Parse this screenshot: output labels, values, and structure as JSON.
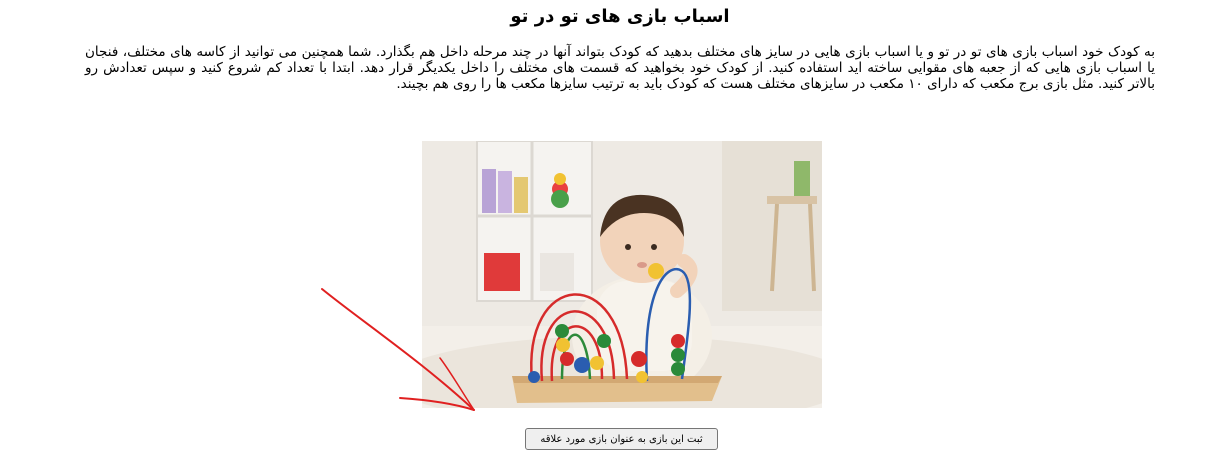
{
  "article": {
    "title": "اسباب بازی های تو در تو",
    "paragraph": "به کودک خود اسباب بازی های تو در تو و یا اسباب بازی هایی در سایز های مختلف بدهید که کودک بتواند آنها در چند مرحله داخل هم بگذارد. شما همچنین می توانید از کاسه های مختلف، فنجان یا اسباب بازی هایی که از جعبه های مقوایی ساخته اید استفاده کنید. از کودک خود بخواهید که قسمت های مختلف را داخل یکدیگر قرار دهد. ابتدا با تعداد کم شروع کنید و سپس تعدادش رو بالاتر کنید. مثل بازی برج مکعب که دارای ۱۰ مکعب در سایزهای مختلف هست که کودک باید به ترتیب سایزها مکعب ها را روی هم بچیند."
  },
  "actions": {
    "favorite_button_label": "ثبت این بازی به عنوان بازی مورد علاقه"
  },
  "colors": {
    "annotation_arrow": "#e02020"
  }
}
